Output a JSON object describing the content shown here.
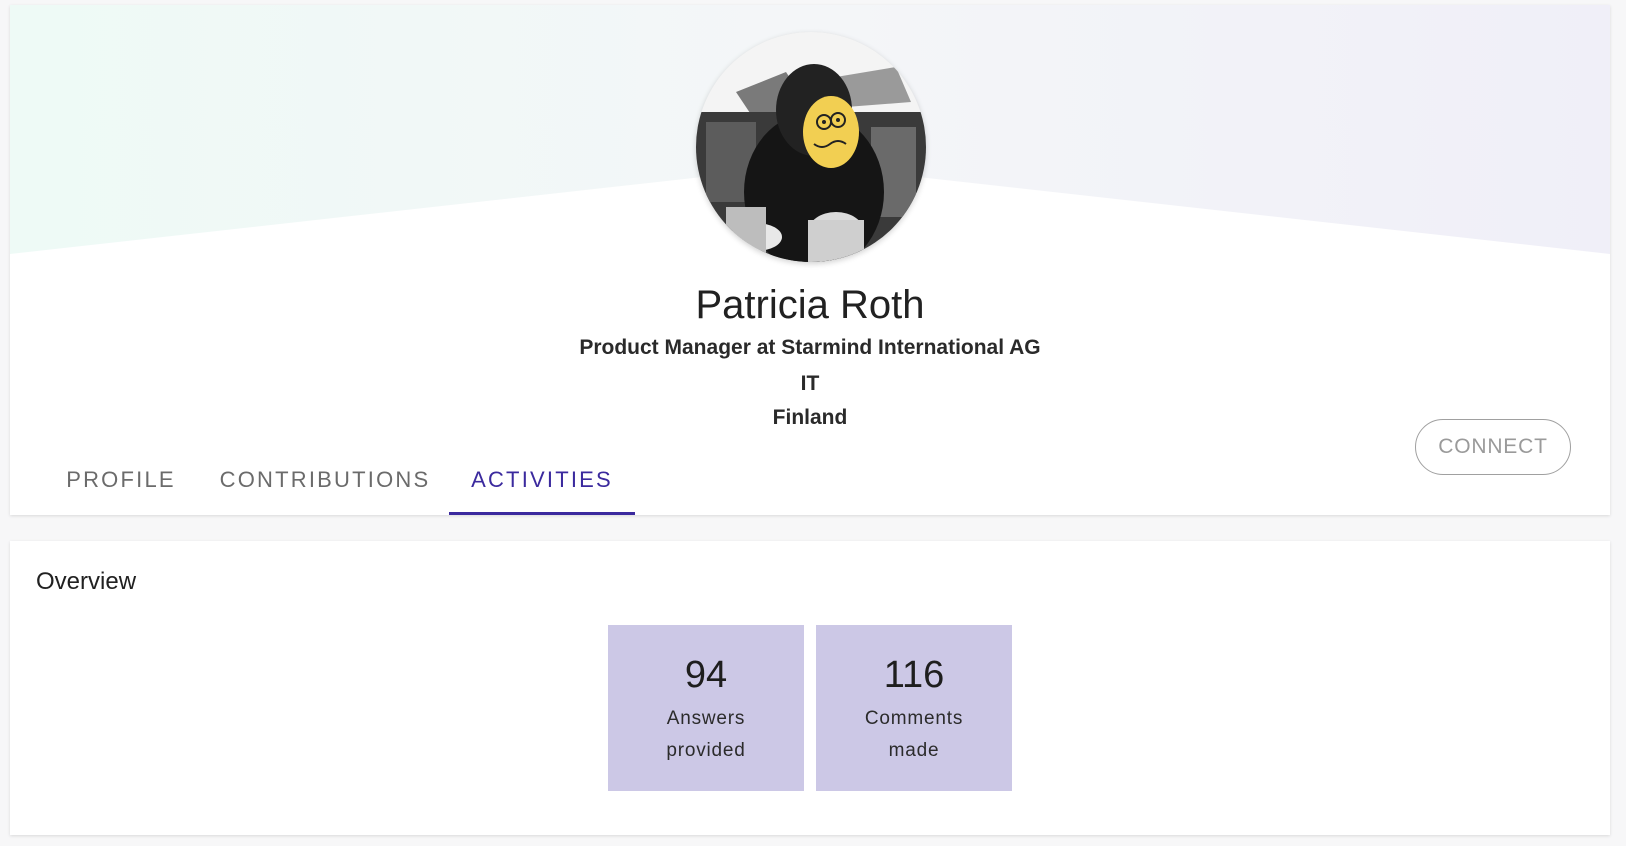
{
  "profile": {
    "name": "Patricia Roth",
    "job_title": "Product Manager at Starmind International AG",
    "department": "IT",
    "country": "Finland"
  },
  "tabs": [
    {
      "label": "PROFILE",
      "active": false
    },
    {
      "label": "CONTRIBUTIONS",
      "active": false
    },
    {
      "label": "ACTIVITIES",
      "active": true
    }
  ],
  "actions": {
    "connect_label": "CONNECT"
  },
  "overview": {
    "title": "Overview",
    "stats": [
      {
        "value": "94",
        "label": "Answers provided"
      },
      {
        "value": "116",
        "label": "Comments made"
      }
    ]
  },
  "colors": {
    "accent": "#3b2a9e",
    "stat_tile": "#ccc8e6",
    "banner_left": "#eefaf6",
    "banner_right": "#f1f0f8"
  },
  "icons": {
    "avatar": "profile-photo-avatar"
  }
}
